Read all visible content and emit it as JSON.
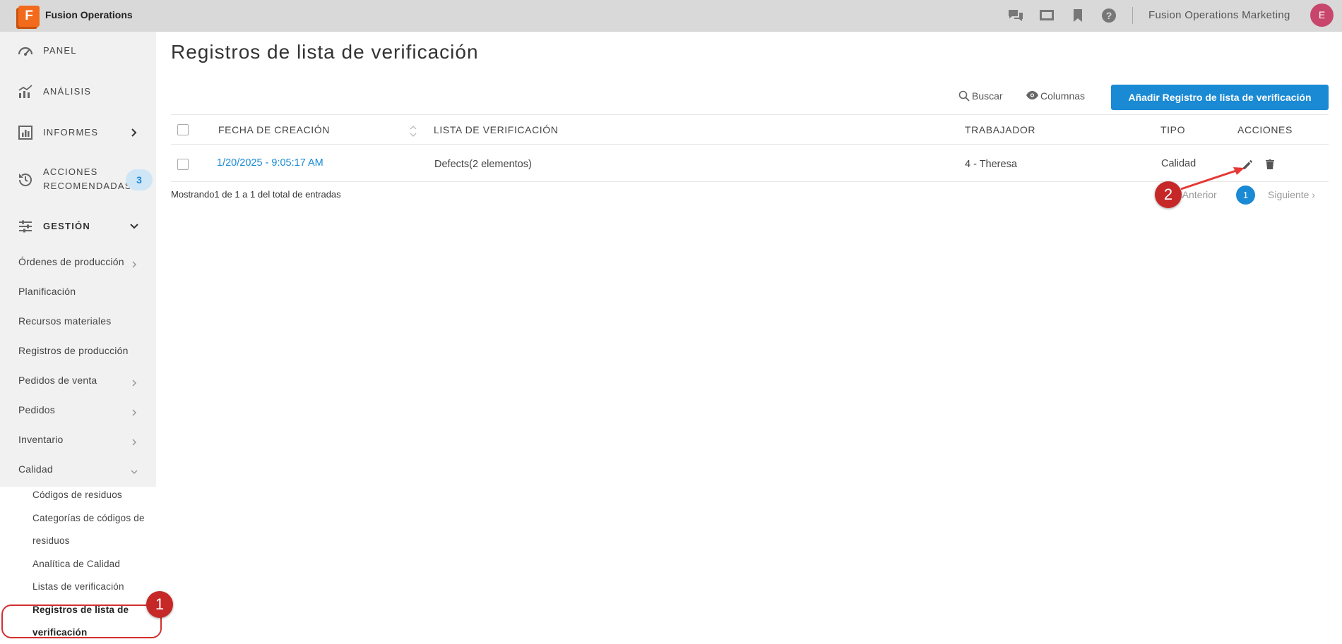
{
  "app": {
    "logo_letter": "F",
    "name": "Fusion Operations",
    "org": "Fusion Operations Marketing",
    "avatar": "E"
  },
  "topbar_icons": [
    "chat-icon",
    "display-icon",
    "bookmark-icon",
    "help-icon"
  ],
  "sidebar": {
    "main": [
      {
        "label": "PANEL",
        "icon": "dashboard-gauge-icon"
      },
      {
        "label": "ANÁLISIS",
        "icon": "analytics-chart-icon"
      },
      {
        "label": "INFORMES",
        "icon": "reports-bar-icon"
      },
      {
        "label_line1": "ACCIONES",
        "label_line2": "RECOMENDADAS",
        "icon": "history-icon",
        "badge": "3"
      },
      {
        "label": "GESTIÓN",
        "icon": "sliders-icon"
      }
    ],
    "sub": [
      "Órdenes de producción",
      "Planificación",
      "Recursos materiales",
      "Registros de producción",
      "Pedidos de venta",
      "Pedidos",
      "Inventario",
      "Calidad"
    ],
    "quality_sub": [
      "Códigos de residuos",
      "Categorías de códigos de",
      "residuos",
      "Analítica de Calidad",
      "Listas de verificación",
      "Registros de lista de",
      "verificación"
    ]
  },
  "page": {
    "title": "Registros de lista de verificación",
    "search_label": "Buscar",
    "columns_label": "Columnas",
    "add_button": "Añadir Registro de lista de verificación"
  },
  "table": {
    "headers": [
      "FECHA DE CREACIÓN",
      "LISTA DE VERIFICACIÓN",
      "TRABAJADOR",
      "TIPO",
      "ACCIONES"
    ],
    "rows": [
      {
        "fecha": "1/20/2025 - 9:05:17 AM",
        "lista": "Defects(2 elementos)",
        "trabajador": "4 - Theresa",
        "tipo": "Calidad"
      }
    ]
  },
  "footer": {
    "showing": "Mostrando1 de 1 a 1 del total de entradas",
    "prev": "Anterior",
    "page": "1",
    "next": "Siguiente"
  },
  "annotations": {
    "marker1": "1",
    "marker2": "2",
    "color": "#d32f2f"
  }
}
